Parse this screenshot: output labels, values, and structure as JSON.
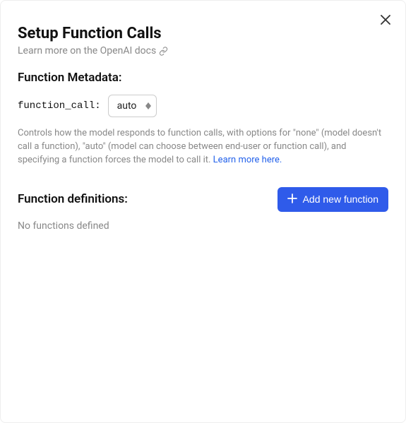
{
  "header": {
    "title": "Setup Function Calls",
    "subtitle": "Learn more on the OpenAI docs"
  },
  "metadata": {
    "heading": "Function Metadata:",
    "function_call_label": "function_call:",
    "function_call_value": "auto",
    "help_text": "Controls how the model responds to function calls, with options for \"none\" (model doesn't call a function), \"auto\" (model can choose between end-user or function call), and specifying a function forces the model to call it. ",
    "help_link_text": "Learn more here."
  },
  "definitions": {
    "heading": "Function definitions:",
    "add_button_label": "Add new function",
    "empty_state": "No functions defined"
  }
}
